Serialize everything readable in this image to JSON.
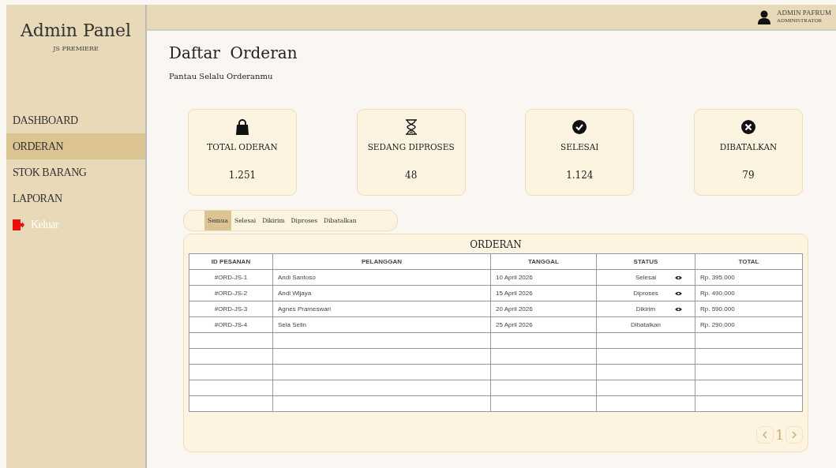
{
  "sidebar": {
    "title": "Admin Panel",
    "subtitle": "JS PREMIERE",
    "items": [
      {
        "label": "DASHBOARD",
        "selected": false,
        "kind": "nav"
      },
      {
        "label": "ORDERAN",
        "selected": true,
        "kind": "nav"
      },
      {
        "label": "STOK BARANG",
        "selected": false,
        "kind": "nav"
      },
      {
        "label": "LAPORAN",
        "selected": false,
        "kind": "nav"
      },
      {
        "label": "Keluar",
        "selected": false,
        "kind": "logout"
      }
    ]
  },
  "topbar": {
    "user_name": "ADMIN PAFRUM",
    "user_role": "ADMINISTRATOR"
  },
  "page": {
    "title": "Daftar  Orderan",
    "subtitle": "Pantau Selalu Orderanmu"
  },
  "stats": [
    {
      "kind": "bag",
      "label": "TOTAL ODERAN",
      "value": "1.251"
    },
    {
      "kind": "hourglass",
      "label": "SEDANG DIPROSES",
      "value": "48"
    },
    {
      "kind": "check",
      "label": "SELESAI",
      "value": "1.124"
    },
    {
      "kind": "cross",
      "label": "DIBATALKAN",
      "value": "79"
    }
  ],
  "filter_tabs": [
    {
      "label": "Semua",
      "selected": true
    },
    {
      "label": "Selesai",
      "selected": false
    },
    {
      "label": "Dikirim",
      "selected": false
    },
    {
      "label": "Diproses",
      "selected": false
    },
    {
      "label": "Dibatalkan",
      "selected": false
    }
  ],
  "table": {
    "title": "ORDERAN",
    "columns": [
      "ID PESANAN",
      "PELANGGAN",
      "TANGGAL",
      "STATUS",
      "TOTAL"
    ],
    "rows": [
      {
        "id": "#ORD-JS-1",
        "customer": "Andi Santoso",
        "date": "10 April 2026",
        "status": "Selesai",
        "view_icon": true,
        "total": "Rp. 395.000"
      },
      {
        "id": "#ORD-JS-2",
        "customer": "Andi Wijaya",
        "date": "15 April 2026",
        "status": "Diproses",
        "view_icon": true,
        "total": "Rp. 490.000"
      },
      {
        "id": "#ORD-JS-3",
        "customer": "Agnes Prameswari",
        "date": "20 April 2026",
        "status": "Dikirim",
        "view_icon": true,
        "total": "Rp. 590.000"
      },
      {
        "id": "#ORD-JS-4",
        "customer": "Sela Selin",
        "date": "25 April 2026",
        "status": "Dibatalkan",
        "view_icon": false,
        "total": "Rp. 290.000"
      }
    ]
  },
  "pagination": {
    "page": "1"
  }
}
